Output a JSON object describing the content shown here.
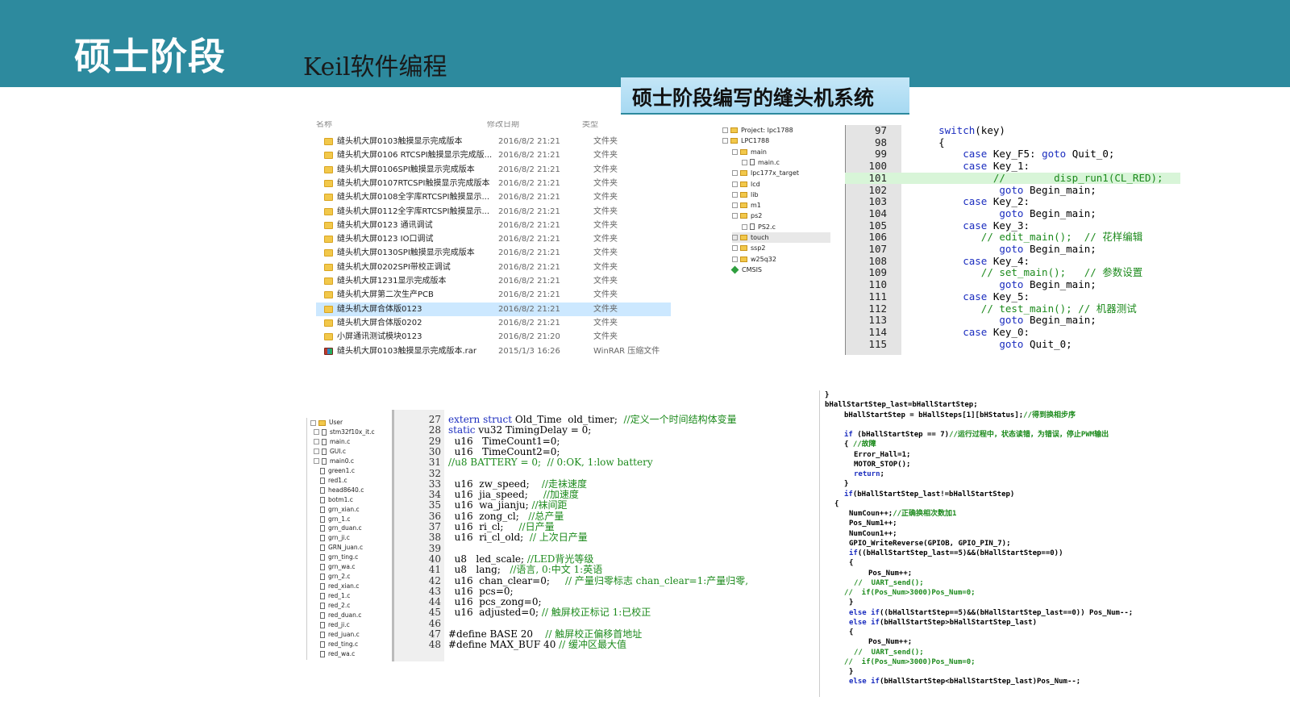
{
  "header": {
    "title": "硕士阶段",
    "subtitle": "Keil软件编程",
    "banner": "硕士阶段编写的缝头机系统"
  },
  "explorer": {
    "columns": [
      "名称",
      "修改日期",
      "类型"
    ],
    "rows": [
      {
        "name": "缝头机大屏0103触摸显示完成版本",
        "date": "2016/8/2 21:21",
        "type": "文件夹"
      },
      {
        "name": "缝头机大屏0106 RTCSPI触摸显示完成版...",
        "date": "2016/8/2 21:21",
        "type": "文件夹"
      },
      {
        "name": "缝头机大屏0106SPI触摸显示完成版本",
        "date": "2016/8/2 21:21",
        "type": "文件夹"
      },
      {
        "name": "缝头机大屏0107RTCSPI触摸显示完成版本",
        "date": "2016/8/2 21:21",
        "type": "文件夹"
      },
      {
        "name": "缝头机大屏0108全字库RTCSPI触摸显示...",
        "date": "2016/8/2 21:21",
        "type": "文件夹"
      },
      {
        "name": "缝头机大屏0112全字库RTCSPI触摸显示...",
        "date": "2016/8/2 21:21",
        "type": "文件夹"
      },
      {
        "name": "缝头机大屏0123  通讯调试",
        "date": "2016/8/2 21:21",
        "type": "文件夹"
      },
      {
        "name": "缝头机大屏0123 IO口调试",
        "date": "2016/8/2 21:21",
        "type": "文件夹"
      },
      {
        "name": "缝头机大屏0130SPI触摸显示完成版本",
        "date": "2016/8/2 21:21",
        "type": "文件夹"
      },
      {
        "name": "缝头机大屏0202SPI带校正调试",
        "date": "2016/8/2 21:21",
        "type": "文件夹"
      },
      {
        "name": "缝头机大屏1231显示完成版本",
        "date": "2016/8/2 21:21",
        "type": "文件夹"
      },
      {
        "name": "缝头机大屏第二次生产PCB",
        "date": "2016/8/2 21:21",
        "type": "文件夹"
      },
      {
        "name": "缝头机大屏合体版0123",
        "date": "2016/8/2 21:21",
        "type": "文件夹",
        "selected": true
      },
      {
        "name": "缝头机大屏合体版0202",
        "date": "2016/8/2 21:21",
        "type": "文件夹"
      },
      {
        "name": "小屏通讯测试模块0123",
        "date": "2016/8/2 21:20",
        "type": "文件夹"
      },
      {
        "name": "缝头机大屏0103触摸显示完成版本.rar",
        "date": "2015/1/3 16:26",
        "type": "WinRAR 压缩文件",
        "rar": true
      }
    ]
  },
  "tree1": {
    "items": [
      {
        "label": "Project: lpc1788",
        "kind": "root",
        "depth": 0
      },
      {
        "label": "LPC1788",
        "kind": "folder",
        "depth": 0
      },
      {
        "label": "main",
        "kind": "folder",
        "depth": 1
      },
      {
        "label": "main.c",
        "kind": "file",
        "depth": 2
      },
      {
        "label": "lpc177x_target",
        "kind": "folder",
        "depth": 1
      },
      {
        "label": "lcd",
        "kind": "folder",
        "depth": 1
      },
      {
        "label": "lib",
        "kind": "folder",
        "depth": 1
      },
      {
        "label": "m1",
        "kind": "folder",
        "depth": 1
      },
      {
        "label": "ps2",
        "kind": "folder",
        "depth": 1
      },
      {
        "label": "PS2.c",
        "kind": "file",
        "depth": 2
      },
      {
        "label": "touch",
        "kind": "folder",
        "depth": 1,
        "selected": true
      },
      {
        "label": "ssp2",
        "kind": "folder",
        "depth": 1
      },
      {
        "label": "w25q32",
        "kind": "folder",
        "depth": 1
      },
      {
        "label": "CMSIS",
        "kind": "diamond",
        "depth": 1
      }
    ]
  },
  "code1": {
    "lines": [
      {
        "n": "97",
        "t": "    switch(key)"
      },
      {
        "n": "98",
        "t": "    {"
      },
      {
        "n": "99",
        "t": "        case Key_F5: goto Quit_0;"
      },
      {
        "n": "100",
        "t": "        case Key_1:"
      },
      {
        "n": "101",
        "t": "             //        disp_run1(CL_RED);",
        "hl": true
      },
      {
        "n": "102",
        "t": "              goto Begin_main;"
      },
      {
        "n": "103",
        "t": "        case Key_2:"
      },
      {
        "n": "104",
        "t": "              goto Begin_main;"
      },
      {
        "n": "105",
        "t": "        case Key_3:"
      },
      {
        "n": "106",
        "t": "           // edit_main();  // 花样编辑"
      },
      {
        "n": "107",
        "t": "              goto Begin_main;"
      },
      {
        "n": "108",
        "t": "        case Key_4:"
      },
      {
        "n": "109",
        "t": "           // set_main();   // 参数设置"
      },
      {
        "n": "110",
        "t": "              goto Begin_main;"
      },
      {
        "n": "111",
        "t": "        case Key_5:"
      },
      {
        "n": "112",
        "t": "           // test_main(); // 机器测试"
      },
      {
        "n": "113",
        "t": "              goto Begin_main;"
      },
      {
        "n": "114",
        "t": "        case Key_0:"
      },
      {
        "n": "115",
        "t": "              goto Quit_0;"
      }
    ]
  },
  "tree2": {
    "items": [
      "User",
      "stm32f10x_it.c",
      "main.c",
      "GUI.c",
      "main0.c",
      "green1.c",
      "red1.c",
      "head8640.c",
      "botm1.c",
      "grn_xian.c",
      "grn_1.c",
      "grn_duan.c",
      "grn_ji.c",
      "GRN_juan.c",
      "grn_ting.c",
      "grn_wa.c",
      "grn_2.c",
      "red_xian.c",
      "red_1.c",
      "red_2.c",
      "red_duan.c",
      "red_ji.c",
      "red_juan.c",
      "red_ting.c",
      "red_wa.c"
    ]
  },
  "code2": {
    "lines": [
      {
        "n": "27",
        "t": "extern struct Old_Time  old_timer;  //定义一个时间结构体变量"
      },
      {
        "n": "28",
        "t": "static vu32 TimingDelay = 0;"
      },
      {
        "n": "29",
        "t": "  u16   TimeCount1=0;"
      },
      {
        "n": "30",
        "t": "  u16   TimeCount2=0;"
      },
      {
        "n": "31",
        "t": "//u8 BATTERY = 0;  // 0:OK, 1:low battery"
      },
      {
        "n": "32",
        "t": ""
      },
      {
        "n": "33",
        "t": "  u16  zw_speed;    //走袜速度"
      },
      {
        "n": "34",
        "t": "  u16  jia_speed;     //加速度"
      },
      {
        "n": "35",
        "t": "  u16  wa_jianju; //袜间距"
      },
      {
        "n": "36",
        "t": "  u16  zong_cl;   //总产量"
      },
      {
        "n": "37",
        "t": "  u16  ri_cl;     //日产量"
      },
      {
        "n": "38",
        "t": "  u16  ri_cl_old;  // 上次日产量"
      },
      {
        "n": "39",
        "t": ""
      },
      {
        "n": "40",
        "t": "  u8   led_scale; //LED背光等级"
      },
      {
        "n": "41",
        "t": "  u8   lang;   //语言, 0:中文 1:英语"
      },
      {
        "n": "42",
        "t": "  u16  chan_clear=0;     // 产量归零标志 chan_clear=1:产量归零,"
      },
      {
        "n": "43",
        "t": "  u16  pcs=0;"
      },
      {
        "n": "44",
        "t": "  u16  pcs_zong=0;"
      },
      {
        "n": "45",
        "t": "  u16  adjusted=0; // 触屏校正标记 1:已校正"
      },
      {
        "n": "46",
        "t": ""
      },
      {
        "n": "47",
        "t": "#define BASE 20    // 触屏校正偏移首地址"
      },
      {
        "n": "48",
        "t": "#define MAX_BUF 40 // 缓冲区最大值"
      }
    ]
  },
  "code3": {
    "lines": [
      {
        "i": 0,
        "t": "}"
      },
      {
        "i": 0,
        "t": "bHallStartStep_last=bHallStartStep;"
      },
      {
        "i": 4,
        "t": "bHallStartStep = bHallSteps[1][bHStatus];//得到换相步序"
      },
      {
        "i": 0,
        "t": ""
      },
      {
        "i": 4,
        "t": "if (bHallStartStep == 7)//运行过程中，状态读错，为错误，停止PWM输出"
      },
      {
        "i": 4,
        "t": "{ //故障"
      },
      {
        "i": 6,
        "t": "Error_Hall=1;"
      },
      {
        "i": 6,
        "t": "MOTOR_STOP();"
      },
      {
        "i": 6,
        "t": "return;"
      },
      {
        "i": 4,
        "t": "}"
      },
      {
        "i": 4,
        "t": "if(bHallStartStep_last!=bHallStartStep)"
      },
      {
        "i": 2,
        "t": "{"
      },
      {
        "i": 5,
        "t": "NumCoun++;//正确换相次数加1"
      },
      {
        "i": 5,
        "t": "Pos_Num1++;"
      },
      {
        "i": 5,
        "t": "NumCoun1++;"
      },
      {
        "i": 5,
        "t": "GPIO_WriteReverse(GPIOB, GPIO_PIN_7);"
      },
      {
        "i": 5,
        "t": "if((bHallStartStep_last==5)&&(bHallStartStep==0))"
      },
      {
        "i": 5,
        "t": "{"
      },
      {
        "i": 9,
        "t": "Pos_Num++;"
      },
      {
        "i": 6,
        "t": "//  UART_send();"
      },
      {
        "i": 4,
        "t": "//  if(Pos_Num>3000)Pos_Num=0;"
      },
      {
        "i": 5,
        "t": "}"
      },
      {
        "i": 5,
        "t": "else if((bHallStartStep==5)&&(bHallStartStep_last==0)) Pos_Num--;"
      },
      {
        "i": 5,
        "t": "else if(bHallStartStep>bHallStartStep_last)"
      },
      {
        "i": 5,
        "t": "{"
      },
      {
        "i": 9,
        "t": "Pos_Num++;"
      },
      {
        "i": 6,
        "t": "//  UART_send();"
      },
      {
        "i": 4,
        "t": "//  if(Pos_Num>3000)Pos_Num=0;"
      },
      {
        "i": 5,
        "t": "}"
      },
      {
        "i": 5,
        "t": "else if(bHallStartStep<bHallStartStep_last)Pos_Num--;"
      }
    ]
  }
}
